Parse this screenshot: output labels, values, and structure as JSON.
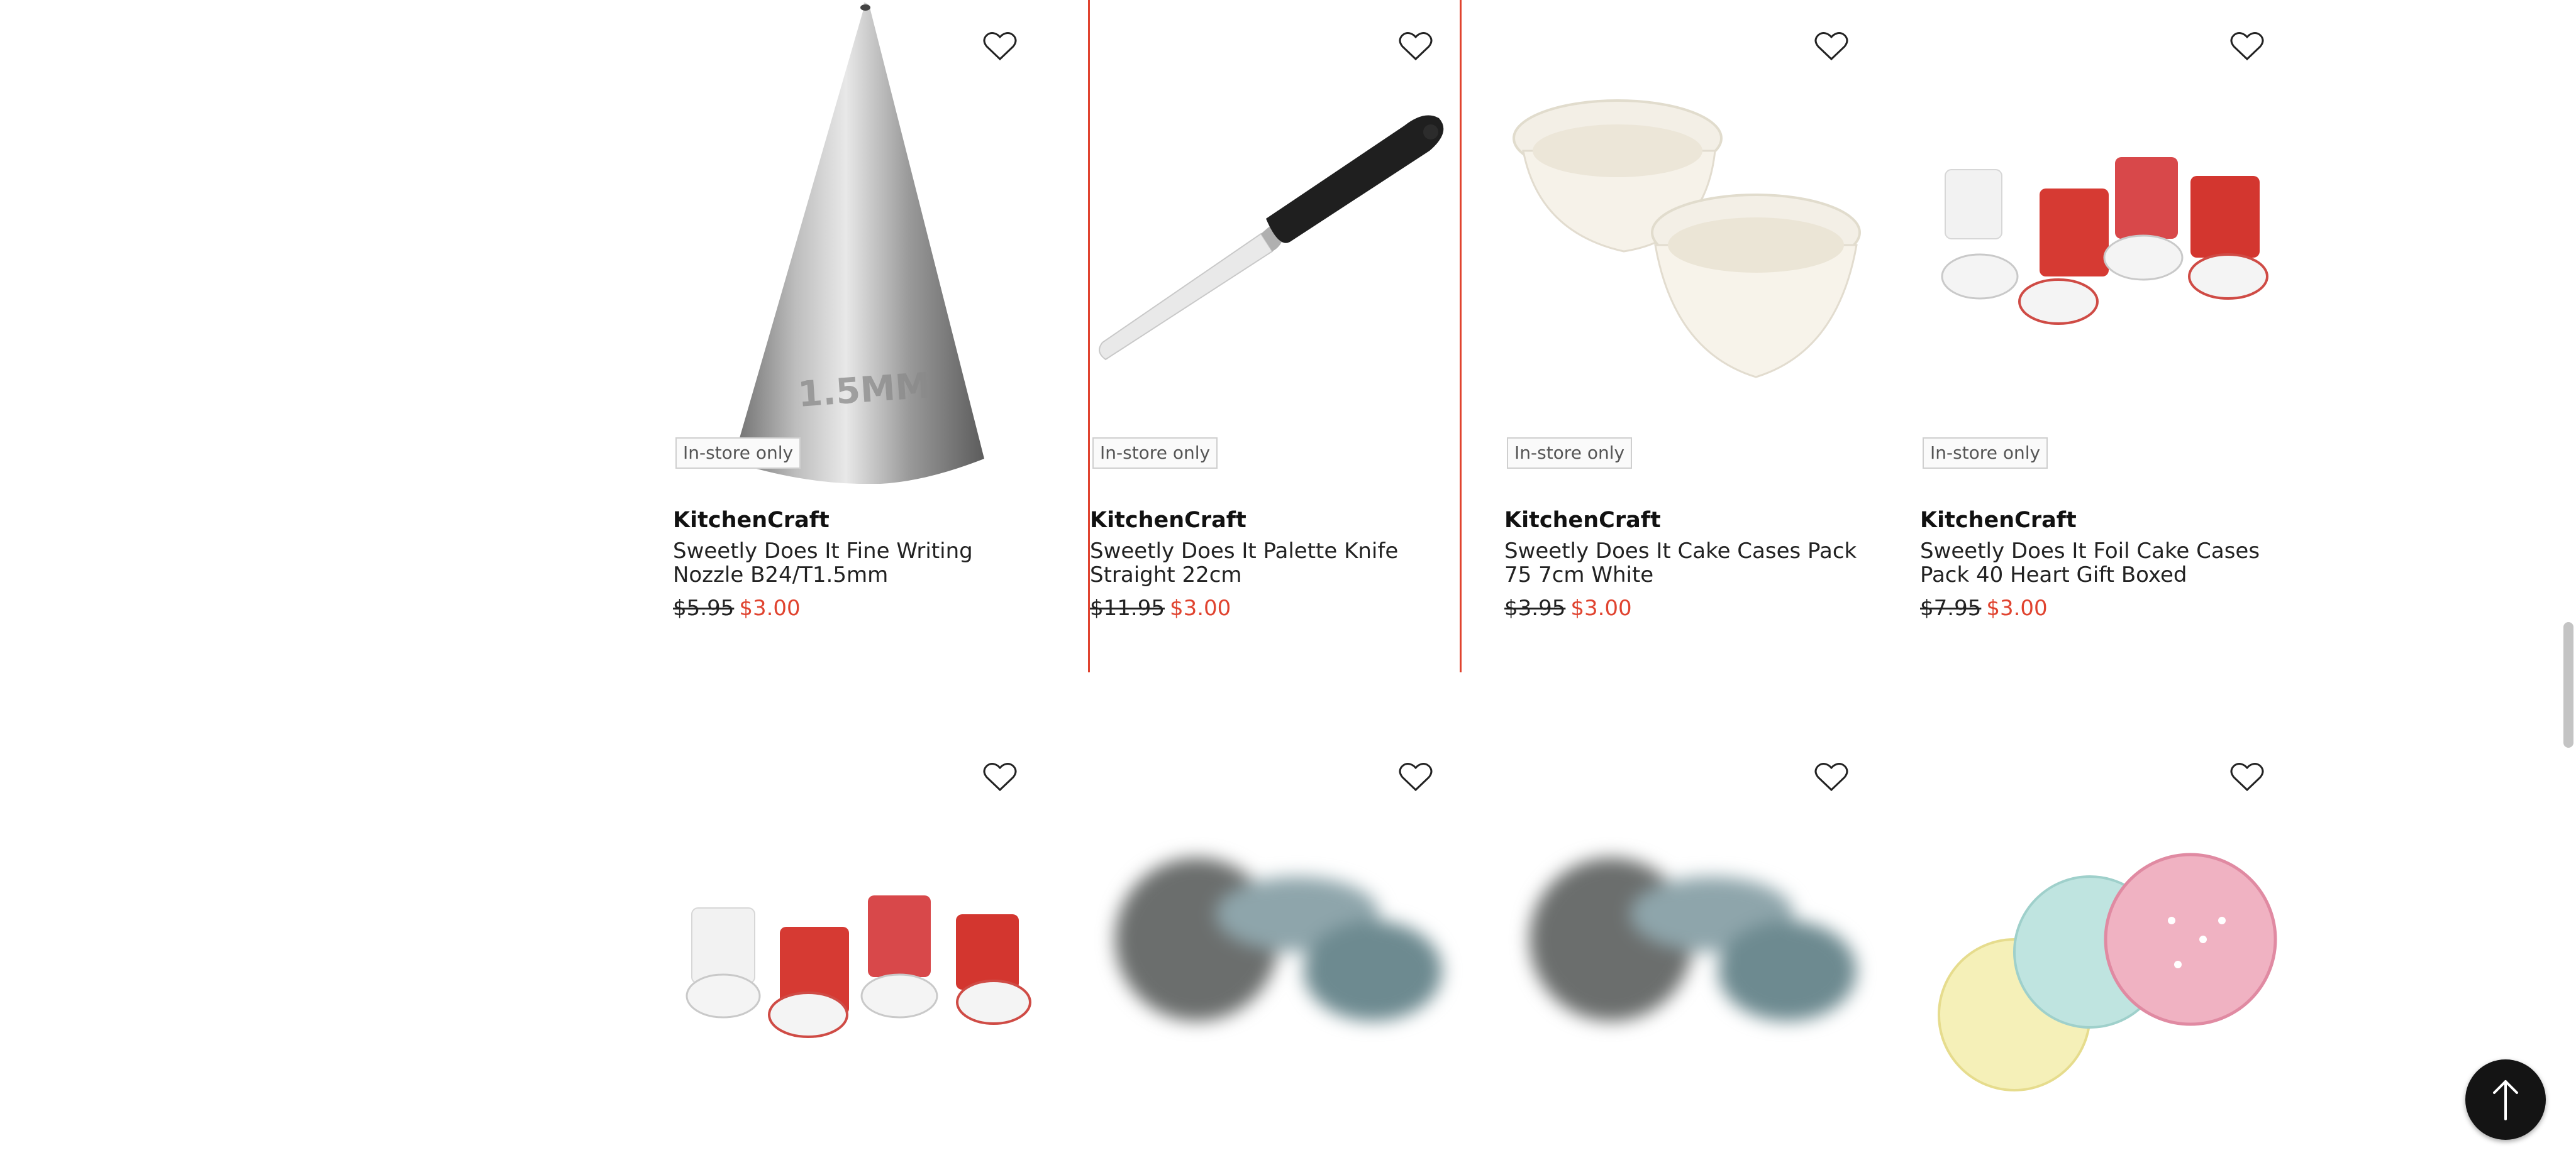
{
  "products": [
    {
      "brand": "KitchenCraft",
      "title": "Sweetly Does It Fine Writing Nozzle B24/T1.5mm",
      "old_price": "$5.95",
      "price": "$3.00",
      "badge": "In-store only",
      "image_icon": "piping-nozzle-image",
      "nozzle_label": "1.5MM"
    },
    {
      "brand": "KitchenCraft",
      "title": "Sweetly Does It Palette Knife Straight 22cm",
      "old_price": "$11.95",
      "price": "$3.00",
      "badge": "In-store only",
      "image_icon": "palette-knife-image"
    },
    {
      "brand": "KitchenCraft",
      "title": "Sweetly Does It Cake Cases Pack 75 7cm White",
      "old_price": "$3.95",
      "price": "$3.00",
      "badge": "In-store only",
      "image_icon": "white-cake-cases-image"
    },
    {
      "brand": "KitchenCraft",
      "title": "Sweetly Does It Foil Cake Cases Pack 40 Heart Gift Boxed",
      "old_price": "$7.95",
      "price": "$3.00",
      "badge": "In-store only",
      "image_icon": "heart-cake-cases-image"
    }
  ],
  "row2_images": [
    "polka-cake-cases-image",
    "blurred-bakeware-image",
    "blurred-bakeware-image",
    "pastel-doilies-image"
  ],
  "colors": {
    "accent": "#e0432f",
    "back_to_top": "#141414",
    "badge_border": "#cfcfcf"
  },
  "icons": {
    "wishlist": "heart-outline-icon",
    "back_to_top": "arrow-up-icon"
  }
}
